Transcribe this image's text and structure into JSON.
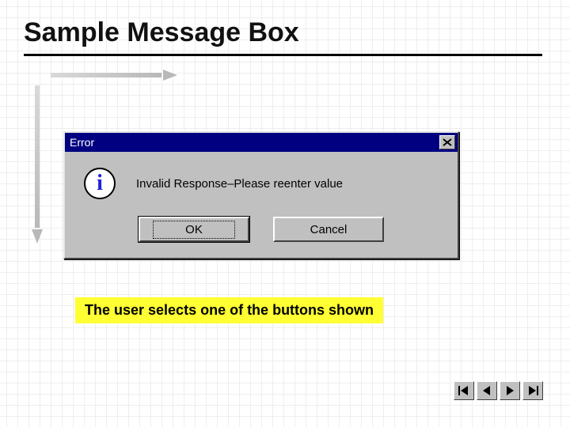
{
  "slide": {
    "title": "Sample Message Box",
    "caption": "The user selects one of the buttons shown"
  },
  "dialog": {
    "titlebar": {
      "title": "Error"
    },
    "message": "Invalid Response–Please reenter value",
    "icon": "info-icon",
    "buttons": {
      "ok_label": "OK",
      "cancel_label": "Cancel"
    }
  },
  "nav": {
    "first": "first-slide",
    "prev": "previous-slide",
    "next": "next-slide",
    "last": "last-slide"
  },
  "colors": {
    "titlebar_bg": "#000080",
    "dialog_bg": "#c0c0c0",
    "caption_bg": "#ffff33"
  }
}
